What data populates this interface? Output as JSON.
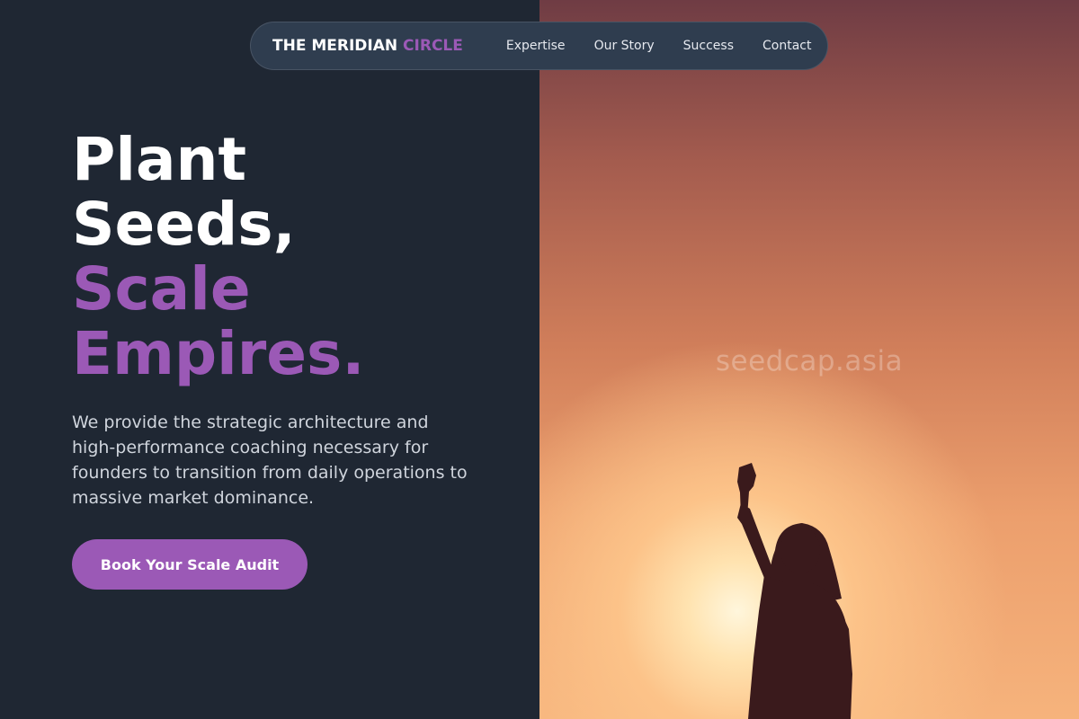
{
  "nav": {
    "brand_main": "THE MERIDIAN",
    "brand_accent": "CIRCLE",
    "links": [
      "Expertise",
      "Our Story",
      "Success",
      "Contact"
    ]
  },
  "hero": {
    "headline_line1": "Plant",
    "headline_line2": "Seeds,",
    "headline_line3": "Scale",
    "headline_line4": "Empires.",
    "subtext": "We provide the strategic architecture and high-performance coaching necessary for founders to transition from daily operations to massive market dominance.",
    "cta_label": "Book Your Scale Audit"
  },
  "image": {
    "watermark": "seedcap.asia",
    "description_icon": "raised-fist-silhouette-sunset"
  },
  "colors": {
    "background": "#1f2733",
    "accent": "#9b59b6",
    "nav_bg": "#2f3d4f"
  }
}
